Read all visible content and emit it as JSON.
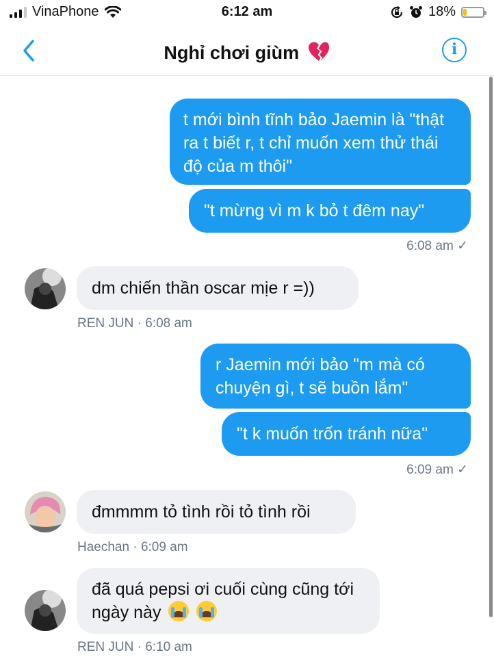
{
  "status_bar": {
    "carrier": "VinaPhone",
    "time": "6:12 am",
    "battery": "18%",
    "battery_level": 0.18
  },
  "nav": {
    "title": "Nghỉ chơi giùm",
    "title_icon": "broken-heart-icon",
    "info_label": "i"
  },
  "messages": [
    {
      "direction": "out",
      "text": "t mới bình tĩnh bảo Jaemin là \"thật ra t biết r, t chỉ muốn xem thử thái độ của m thôi\""
    },
    {
      "direction": "out",
      "text": "\"t mừng vì m k bỏ t đêm nay\""
    },
    {
      "direction": "out_meta",
      "text": "6:08 am ✓"
    },
    {
      "direction": "in",
      "text": "dm chiến thần oscar mịe r =))"
    },
    {
      "direction": "in_meta",
      "text": "REN JUN · 6:08 am"
    },
    {
      "direction": "out",
      "text": "r Jaemin mới bảo \"m mà có chuyện gì, t sẽ buồn lắm\""
    },
    {
      "direction": "out",
      "text": "\"t k muốn trốn tránh nữa\""
    },
    {
      "direction": "out_meta",
      "text": "6:09 am ✓"
    },
    {
      "direction": "in",
      "text": "đmmmm tỏ tình rồi tỏ tình rồi"
    },
    {
      "direction": "in_meta",
      "text": "Haechan · 6:09 am"
    },
    {
      "direction": "in",
      "text": "đã quá pepsi ơi cuối cùng cũng tới ngày này"
    },
    {
      "direction": "in_meta",
      "text": "REN JUN · 6:10 am"
    }
  ],
  "colors": {
    "outgoing_bubble": "#1d9bf0",
    "incoming_bubble": "#eef0f3",
    "accent": "#1d9bf0"
  }
}
